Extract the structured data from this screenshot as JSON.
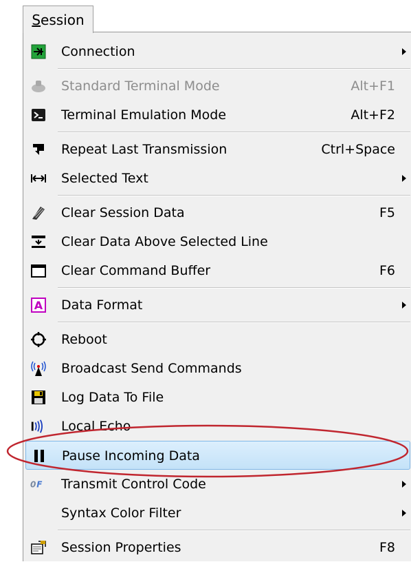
{
  "menu": {
    "title": "Session",
    "title_mnemonic": "S",
    "title_rest": "ession"
  },
  "items": [
    {
      "label": "Connection",
      "shortcut": "",
      "submenu": true,
      "icon": "connection-icon"
    },
    {
      "label": "Standard Terminal Mode",
      "shortcut": "Alt+F1",
      "disabled": true,
      "icon": "terminal-standard-icon"
    },
    {
      "label": "Terminal Emulation Mode",
      "shortcut": "Alt+F2",
      "icon": "terminal-emulation-icon"
    },
    {
      "label": "Repeat Last Transmission",
      "shortcut": "Ctrl+Space",
      "icon": "repeat-icon"
    },
    {
      "label": "Selected Text",
      "shortcut": "",
      "submenu": true,
      "icon": "selected-text-icon"
    },
    {
      "label": "Clear Session Data",
      "shortcut": "F5",
      "icon": "clear-session-icon"
    },
    {
      "label": "Clear Data Above Selected Line",
      "shortcut": "",
      "icon": "clear-above-icon"
    },
    {
      "label": "Clear Command Buffer",
      "shortcut": "F6",
      "icon": "clear-buffer-icon"
    },
    {
      "label": "Data Format",
      "shortcut": "",
      "submenu": true,
      "icon": "data-format-icon"
    },
    {
      "label": "Reboot",
      "shortcut": "",
      "icon": "reboot-icon"
    },
    {
      "label": "Broadcast Send Commands",
      "shortcut": "",
      "icon": "broadcast-icon"
    },
    {
      "label": "Log Data To File",
      "shortcut": "",
      "icon": "save-icon"
    },
    {
      "label": "Local Echo",
      "shortcut": "",
      "icon": "echo-icon"
    },
    {
      "label": "Pause Incoming Data",
      "shortcut": "",
      "highlighted": true,
      "icon": "pause-icon"
    },
    {
      "label": "Transmit Control Code",
      "shortcut": "",
      "submenu": true,
      "icon": "control-code-icon"
    },
    {
      "label": "Syntax Color Filter",
      "shortcut": "",
      "submenu": true,
      "icon": ""
    },
    {
      "label": "Session Properties",
      "shortcut": "F8",
      "icon": "properties-icon"
    }
  ],
  "colors": {
    "menu_bg": "#f0f0f0",
    "highlight": "#c4e2f8",
    "annotation": "#c0262f"
  }
}
